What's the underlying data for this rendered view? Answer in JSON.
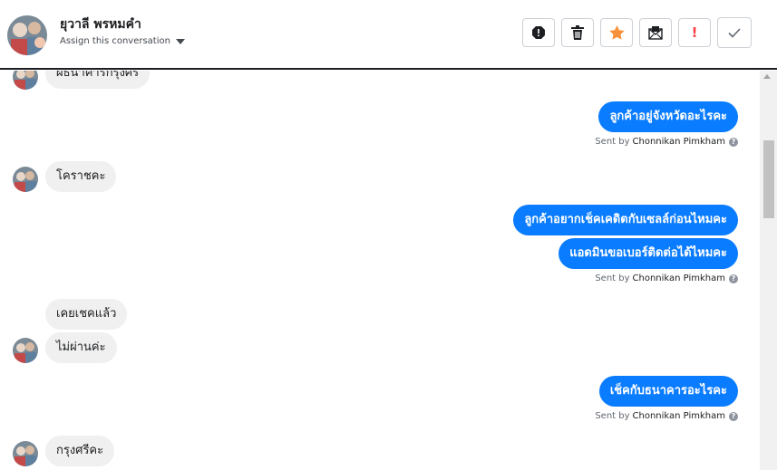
{
  "header": {
    "contact_name": "ยุวาลี พรหมคำ",
    "assign_label": "Assign this conversation"
  },
  "toolbar": {
    "buttons": [
      "spam-alert-icon",
      "trash-icon",
      "star-icon",
      "mark-unread-icon",
      "important-icon",
      "done-check-icon"
    ],
    "important_glyph": "!",
    "star_color": "#f7923b",
    "important_color": "#fa3e3e"
  },
  "messages": {
    "m0": "ผธนาคารกรุงศรี",
    "m1": "ลูกค้าอยู่จังหวัดอะไรคะ",
    "m2": "โคราชคะ",
    "m3": "ลูกค้าอยากเช็คเคดิตกับเซลล์ก่อนไหมคะ",
    "m4": "แอดมินขอเบอร์ติดต่อได้ไหมคะ",
    "m5": "เคยเชคแล้ว",
    "m6": "ไม่ผ่านค่ะ",
    "m7": "เช็คกับธนาคารอะไรคะ",
    "m8": "กรุงศรีคะ"
  },
  "sent_by": {
    "prefix": "Sent by",
    "agent": "Chonnikan Pimkham",
    "help_glyph": "?"
  },
  "colors": {
    "outgoing_bubble": "#0a7cff",
    "incoming_bubble": "#f0f0f0"
  }
}
